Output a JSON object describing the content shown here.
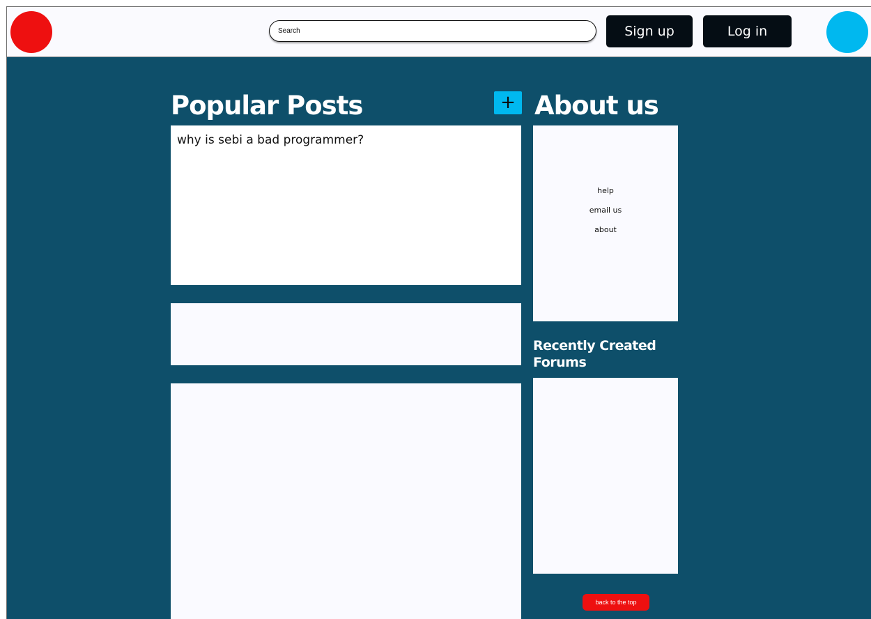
{
  "header": {
    "search": {
      "placeholder": "Search"
    },
    "signup_label": "Sign up",
    "login_label": "Log in"
  },
  "main": {
    "popular_title": "Popular Posts",
    "add_post_label": "+",
    "posts": [
      {
        "title": "why is sebi a bad programmer?"
      },
      {
        "title": ""
      },
      {
        "title": ""
      }
    ]
  },
  "sidebar": {
    "about_title": "About us",
    "about_links": [
      "help",
      "email us",
      "about"
    ],
    "recent_title": "Recently Created Forums",
    "back_to_top_label": "back to the top"
  },
  "colors": {
    "background": "#0e4f6a",
    "logo": "#ee1010",
    "avatar": "#00b8ef",
    "button_dark": "#050d14",
    "accent_blue": "#00b8ef",
    "accent_red": "#ee1010"
  }
}
